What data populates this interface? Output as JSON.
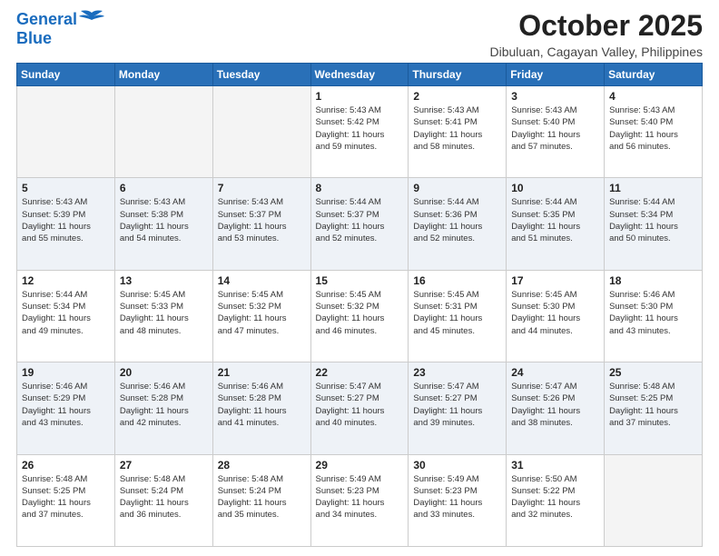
{
  "header": {
    "logo_general": "General",
    "logo_blue": "Blue",
    "month_title": "October 2025",
    "subtitle": "Dibuluan, Cagayan Valley, Philippines"
  },
  "weekdays": [
    "Sunday",
    "Monday",
    "Tuesday",
    "Wednesday",
    "Thursday",
    "Friday",
    "Saturday"
  ],
  "weeks": [
    [
      {
        "day": "",
        "info": ""
      },
      {
        "day": "",
        "info": ""
      },
      {
        "day": "",
        "info": ""
      },
      {
        "day": "1",
        "info": "Sunrise: 5:43 AM\nSunset: 5:42 PM\nDaylight: 11 hours\nand 59 minutes."
      },
      {
        "day": "2",
        "info": "Sunrise: 5:43 AM\nSunset: 5:41 PM\nDaylight: 11 hours\nand 58 minutes."
      },
      {
        "day": "3",
        "info": "Sunrise: 5:43 AM\nSunset: 5:40 PM\nDaylight: 11 hours\nand 57 minutes."
      },
      {
        "day": "4",
        "info": "Sunrise: 5:43 AM\nSunset: 5:40 PM\nDaylight: 11 hours\nand 56 minutes."
      }
    ],
    [
      {
        "day": "5",
        "info": "Sunrise: 5:43 AM\nSunset: 5:39 PM\nDaylight: 11 hours\nand 55 minutes."
      },
      {
        "day": "6",
        "info": "Sunrise: 5:43 AM\nSunset: 5:38 PM\nDaylight: 11 hours\nand 54 minutes."
      },
      {
        "day": "7",
        "info": "Sunrise: 5:43 AM\nSunset: 5:37 PM\nDaylight: 11 hours\nand 53 minutes."
      },
      {
        "day": "8",
        "info": "Sunrise: 5:44 AM\nSunset: 5:37 PM\nDaylight: 11 hours\nand 52 minutes."
      },
      {
        "day": "9",
        "info": "Sunrise: 5:44 AM\nSunset: 5:36 PM\nDaylight: 11 hours\nand 52 minutes."
      },
      {
        "day": "10",
        "info": "Sunrise: 5:44 AM\nSunset: 5:35 PM\nDaylight: 11 hours\nand 51 minutes."
      },
      {
        "day": "11",
        "info": "Sunrise: 5:44 AM\nSunset: 5:34 PM\nDaylight: 11 hours\nand 50 minutes."
      }
    ],
    [
      {
        "day": "12",
        "info": "Sunrise: 5:44 AM\nSunset: 5:34 PM\nDaylight: 11 hours\nand 49 minutes."
      },
      {
        "day": "13",
        "info": "Sunrise: 5:45 AM\nSunset: 5:33 PM\nDaylight: 11 hours\nand 48 minutes."
      },
      {
        "day": "14",
        "info": "Sunrise: 5:45 AM\nSunset: 5:32 PM\nDaylight: 11 hours\nand 47 minutes."
      },
      {
        "day": "15",
        "info": "Sunrise: 5:45 AM\nSunset: 5:32 PM\nDaylight: 11 hours\nand 46 minutes."
      },
      {
        "day": "16",
        "info": "Sunrise: 5:45 AM\nSunset: 5:31 PM\nDaylight: 11 hours\nand 45 minutes."
      },
      {
        "day": "17",
        "info": "Sunrise: 5:45 AM\nSunset: 5:30 PM\nDaylight: 11 hours\nand 44 minutes."
      },
      {
        "day": "18",
        "info": "Sunrise: 5:46 AM\nSunset: 5:30 PM\nDaylight: 11 hours\nand 43 minutes."
      }
    ],
    [
      {
        "day": "19",
        "info": "Sunrise: 5:46 AM\nSunset: 5:29 PM\nDaylight: 11 hours\nand 43 minutes."
      },
      {
        "day": "20",
        "info": "Sunrise: 5:46 AM\nSunset: 5:28 PM\nDaylight: 11 hours\nand 42 minutes."
      },
      {
        "day": "21",
        "info": "Sunrise: 5:46 AM\nSunset: 5:28 PM\nDaylight: 11 hours\nand 41 minutes."
      },
      {
        "day": "22",
        "info": "Sunrise: 5:47 AM\nSunset: 5:27 PM\nDaylight: 11 hours\nand 40 minutes."
      },
      {
        "day": "23",
        "info": "Sunrise: 5:47 AM\nSunset: 5:27 PM\nDaylight: 11 hours\nand 39 minutes."
      },
      {
        "day": "24",
        "info": "Sunrise: 5:47 AM\nSunset: 5:26 PM\nDaylight: 11 hours\nand 38 minutes."
      },
      {
        "day": "25",
        "info": "Sunrise: 5:48 AM\nSunset: 5:25 PM\nDaylight: 11 hours\nand 37 minutes."
      }
    ],
    [
      {
        "day": "26",
        "info": "Sunrise: 5:48 AM\nSunset: 5:25 PM\nDaylight: 11 hours\nand 37 minutes."
      },
      {
        "day": "27",
        "info": "Sunrise: 5:48 AM\nSunset: 5:24 PM\nDaylight: 11 hours\nand 36 minutes."
      },
      {
        "day": "28",
        "info": "Sunrise: 5:48 AM\nSunset: 5:24 PM\nDaylight: 11 hours\nand 35 minutes."
      },
      {
        "day": "29",
        "info": "Sunrise: 5:49 AM\nSunset: 5:23 PM\nDaylight: 11 hours\nand 34 minutes."
      },
      {
        "day": "30",
        "info": "Sunrise: 5:49 AM\nSunset: 5:23 PM\nDaylight: 11 hours\nand 33 minutes."
      },
      {
        "day": "31",
        "info": "Sunrise: 5:50 AM\nSunset: 5:22 PM\nDaylight: 11 hours\nand 32 minutes."
      },
      {
        "day": "",
        "info": ""
      }
    ]
  ]
}
